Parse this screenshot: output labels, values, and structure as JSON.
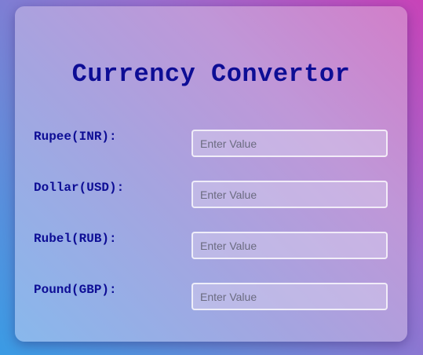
{
  "title": "Currency Convertor",
  "fields": [
    {
      "label": "Rupee(INR):",
      "value": "",
      "placeholder": "Enter Value"
    },
    {
      "label": "Dollar(USD):",
      "value": "",
      "placeholder": "Enter Value"
    },
    {
      "label": "Rubel(RUB):",
      "value": "",
      "placeholder": "Enter Value"
    },
    {
      "label": "Pound(GBP):",
      "value": "",
      "placeholder": "Enter Value"
    }
  ],
  "colors": {
    "text": "#0d0d95"
  }
}
